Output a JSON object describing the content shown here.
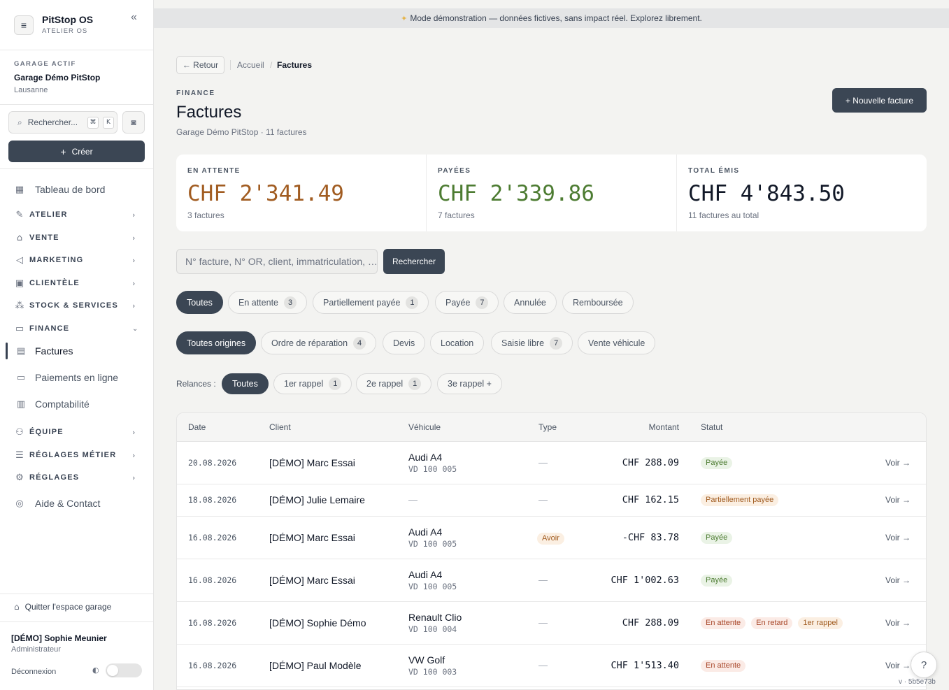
{
  "sidebar": {
    "brand_name": "PitStop OS",
    "brand_sub": "ATELIER OS",
    "garage_label": "GARAGE ACTIF",
    "garage_name": "Garage Démo PitStop",
    "garage_city": "Lausanne",
    "search_placeholder": "Rechercher...",
    "kbd_cmd": "⌘",
    "kbd_k": "K",
    "create_label": "Créer",
    "nav": {
      "dashboard": "Tableau de bord",
      "atelier": "ATELIER",
      "vente": "VENTE",
      "marketing": "MARKETING",
      "clientele": "CLIENTÈLE",
      "stock": "STOCK & SERVICES",
      "finance": "FINANCE",
      "factures": "Factures",
      "paiements": "Paiements en ligne",
      "comptabilite": "Comptabilité",
      "equipe": "ÉQUIPE",
      "reglages_metier": "RÉGLAGES MÉTIER",
      "reglages": "RÉGLAGES",
      "aide": "Aide & Contact"
    },
    "quit_label": "Quitter l'espace garage",
    "user_name": "[DÉMO] Sophie Meunier",
    "user_role": "Administrateur",
    "logout_label": "Déconnexion"
  },
  "banner": {
    "text": "Mode démonstration — données fictives, sans impact réel. Explorez librement."
  },
  "breadcrumb": {
    "back": "← Retour",
    "home": "Accueil",
    "current": "Factures"
  },
  "header": {
    "section": "FINANCE",
    "title": "Factures",
    "subtitle": "Garage Démo PitStop · 11 factures",
    "new_button": "+ Nouvelle facture"
  },
  "stats": [
    {
      "label": "EN ATTENTE",
      "value": "CHF 2'341.49",
      "count": "3 factures",
      "color": "#a15c21"
    },
    {
      "label": "PAYÉES",
      "value": "CHF 2'339.86",
      "count": "7 factures",
      "color": "#4d7c32"
    },
    {
      "label": "TOTAL ÉMIS",
      "value": "CHF 4'843.50",
      "count": "11 factures au total",
      "color": "#111827"
    }
  ],
  "search": {
    "placeholder": "N° facture, N° OR, client, immatriculation, …",
    "button": "Rechercher"
  },
  "filters": {
    "status": [
      {
        "label": "Toutes",
        "count": "",
        "active": true
      },
      {
        "label": "En attente",
        "count": "3"
      },
      {
        "label": "Partiellement payée",
        "count": "1"
      },
      {
        "label": "Payée",
        "count": "7"
      },
      {
        "label": "Annulée",
        "count": ""
      },
      {
        "label": "Remboursée",
        "count": ""
      }
    ],
    "origin": [
      {
        "label": "Toutes origines",
        "count": "",
        "active": true
      },
      {
        "label": "Ordre de réparation",
        "count": "4"
      },
      {
        "label": "Devis",
        "count": ""
      },
      {
        "label": "Location",
        "count": ""
      },
      {
        "label": "Saisie libre",
        "count": "7"
      },
      {
        "label": "Vente véhicule",
        "count": ""
      }
    ],
    "relances_label": "Relances :",
    "relances": [
      {
        "label": "Toutes",
        "count": "",
        "active": true
      },
      {
        "label": "1er rappel",
        "count": "1"
      },
      {
        "label": "2e rappel",
        "count": "1"
      },
      {
        "label": "3e rappel +",
        "count": ""
      }
    ]
  },
  "table": {
    "headers": {
      "date": "Date",
      "client": "Client",
      "vehicle": "Véhicule",
      "type": "Type",
      "amount": "Montant",
      "status": "Statut"
    },
    "rows": [
      {
        "date": "20.08.2026",
        "client": "[DÉMO] Marc Essai",
        "model": "Audi A4",
        "plate": "VD 100 005",
        "type": "—",
        "amount": "CHF 288.09",
        "statuses": [
          [
            "Payée",
            "paid"
          ]
        ],
        "view": "Voir →"
      },
      {
        "date": "18.08.2026",
        "client": "[DÉMO] Julie Lemaire",
        "model": "",
        "plate": "",
        "type": "—",
        "amount": "CHF 162.15",
        "statuses": [
          [
            "Partiellement payée",
            "partial"
          ]
        ],
        "view": "Voir →"
      },
      {
        "date": "16.08.2026",
        "client": "[DÉMO] Marc Essai",
        "model": "Audi A4",
        "plate": "VD 100 005",
        "type": "Avoir",
        "amount": "-CHF 83.78",
        "statuses": [
          [
            "Payée",
            "paid"
          ]
        ],
        "view": "Voir →"
      },
      {
        "date": "16.08.2026",
        "client": "[DÉMO] Marc Essai",
        "model": "Audi A4",
        "plate": "VD 100 005",
        "type": "—",
        "amount": "CHF 1'002.63",
        "statuses": [
          [
            "Payée",
            "paid"
          ]
        ],
        "view": "Voir →"
      },
      {
        "date": "16.08.2026",
        "client": "[DÉMO] Sophie Démo",
        "model": "Renault Clio",
        "plate": "VD 100 004",
        "type": "—",
        "amount": "CHF 288.09",
        "statuses": [
          [
            "En attente",
            "pending"
          ],
          [
            "En retard",
            "pending"
          ],
          [
            "1er rappel",
            "partial"
          ]
        ],
        "view": "Voir →"
      },
      {
        "date": "16.08.2026",
        "client": "[DÉMO] Paul Modèle",
        "model": "VW Golf",
        "plate": "VD 100 003",
        "type": "—",
        "amount": "CHF 1'513.40",
        "statuses": [
          [
            "En attente",
            "pending"
          ]
        ],
        "view": "Voir →"
      }
    ]
  },
  "footer": {
    "version": "v · 5b5e73b"
  }
}
